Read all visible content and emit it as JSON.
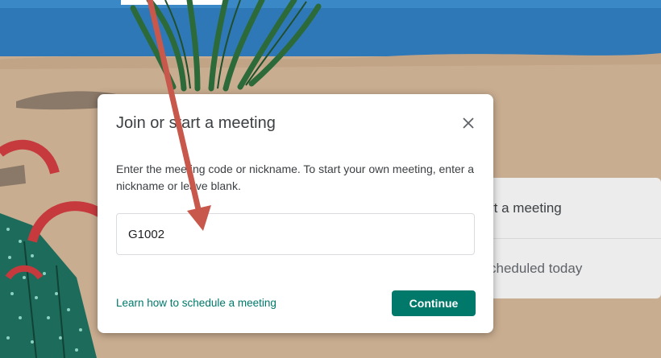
{
  "background_menu": {
    "items": [
      {
        "label": "rt a meeting"
      },
      {
        "label": "cheduled today"
      }
    ]
  },
  "dialog": {
    "title": "Join or start a meeting",
    "description": "Enter the meeting code or nickname. To start your own meeting, enter a nickname or leave blank.",
    "input_value": "G1002",
    "learn_link": "Learn how to schedule a meeting",
    "continue_label": "Continue"
  },
  "colors": {
    "accent": "#00796b",
    "annotation_arrow": "#c8584b"
  },
  "icons": {
    "close": "close-icon"
  }
}
